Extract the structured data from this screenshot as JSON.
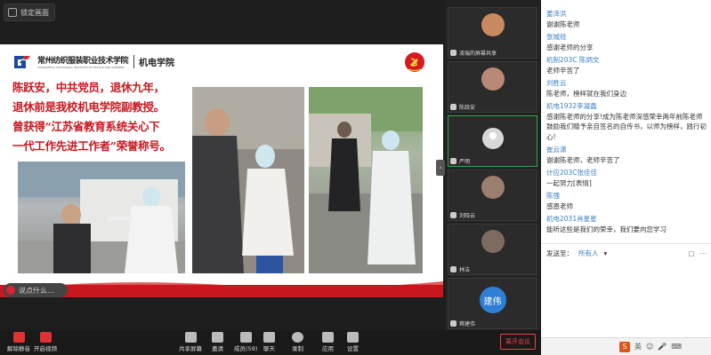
{
  "stage": {
    "lock_label": "锁定画面"
  },
  "slide": {
    "school_name": "常州纺织服装职业技术学院",
    "school_name_en": "CHANGZHOU VOCATIONAL INSTITUTE OF TEXTILE AND GARMENT",
    "dept_name": "机电学院",
    "lines": [
      "陈跃安，中共党员，退休九年，",
      "退休前是我校机电学院副教授。",
      "曾获得“江苏省教育系统关心下",
      "一代工作先进工作者”荣誉称号。"
    ],
    "comment_placeholder": "说点什么..."
  },
  "thumbnails": [
    {
      "name": "凌瑞的屏幕共享",
      "type": "photo",
      "face_color": "#c98a60"
    },
    {
      "name": "陈跃安",
      "type": "photo",
      "face_color": "#b98876"
    },
    {
      "name": "严明",
      "type": "placeholder",
      "active": true
    },
    {
      "name": "刘晓云",
      "type": "photo",
      "face_color": "#9a7e6e"
    },
    {
      "name": "林洁",
      "type": "photo",
      "face_color": "#7e6b5f"
    },
    {
      "name": "蒋建伟",
      "type": "initial",
      "initial": "建伟"
    }
  ],
  "chat": {
    "messages": [
      {
        "sender": "姜泽洪",
        "text": "谢谢陈老师"
      },
      {
        "sender": "张城铨",
        "text": "感谢老师的分享"
      },
      {
        "sender": "机制203C 陈炳文",
        "text": "老师辛苦了"
      },
      {
        "sender": "刘胜云",
        "text": "陈老师，榜样就在我们身边"
      },
      {
        "sender": "机电1932李凝鑫",
        "text": "感谢陈老师的分享!成为陈老师深感荣幸两年前陈老师鼓励我们赠予亲自签名的自传书，以师为榜样，践行初心!"
      },
      {
        "sender": "崔云潇",
        "text": "谢谢陈老师，老师辛苦了"
      },
      {
        "sender": "计应203C张佳佳",
        "text": "一起努力[表情]"
      },
      {
        "sender": "陈强",
        "text": "感恩老师"
      },
      {
        "sender": "机电2031肖星星",
        "text": "能听这些是我们的荣幸，我们要向您学习"
      }
    ],
    "send_to_label": "发送至：",
    "send_to_value": "所有人"
  },
  "toolbar": {
    "mute_label": "解除静音",
    "video_label": "开启视频",
    "share_label": "共享屏幕",
    "invite_label": "邀请",
    "members_label": "成员(59)",
    "chat_label": "聊天",
    "record_label": "录制",
    "apps_label": "应用",
    "settings_label": "设置",
    "leave_label": "离开会议"
  },
  "chat_strip": {
    "ime_label": "英"
  }
}
